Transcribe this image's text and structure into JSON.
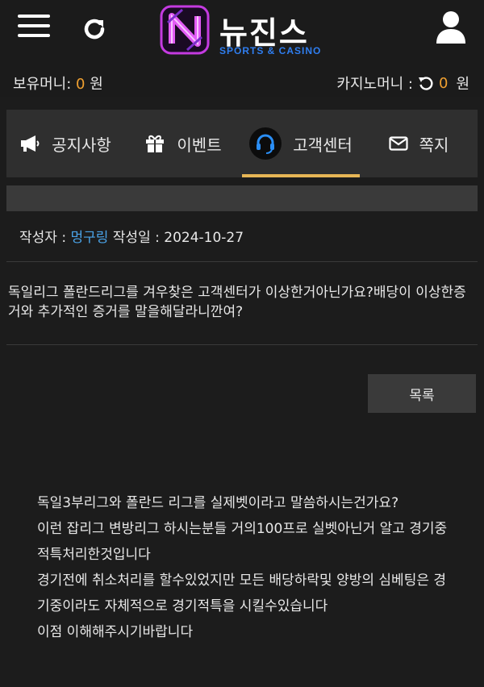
{
  "header": {
    "logo_name": "뉴진스",
    "logo_sub": "SPORTS & CASINO"
  },
  "money": {
    "holding_label": "보유머니:",
    "holding_amount": "0",
    "holding_unit": "원",
    "casino_label": "카지노머니 :",
    "casino_amount": "0",
    "casino_unit": "원"
  },
  "tabs": [
    {
      "label": "공지사항",
      "icon": "megaphone-icon"
    },
    {
      "label": "이벤트",
      "icon": "gift-icon"
    },
    {
      "label": "고객센터",
      "icon": "headset-icon",
      "active": true
    },
    {
      "label": "쪽지",
      "icon": "envelope-icon"
    }
  ],
  "post": {
    "author_label": "작성자 :",
    "author": "멍구링",
    "date_label": "작성일 :",
    "date": "2024-10-27",
    "question": "독일리그 폴란드리그를 겨우찾은 고객센터가 이상한거아닌가요?배당이 이상한증거와 추가적인 증거를 말을해달라니깐여?"
  },
  "buttons": {
    "list_label": "목록"
  },
  "answer": {
    "lines": [
      "독일3부리그와  폴란드 리그를  실제벳이라고  말씀하시는건가요?",
      "이런  잡리그  변방리그 하시는분들  거의100프로  실벳아닌거 알고  경기중  적특처리한것입니다",
      "경기전에  취소처리를  할수있었지만  모든 배당하락및  양방의 심베팅은  경기중이라도  자체적으로  경기적특을  시킬수있습니다",
      "이점  이해해주시기바랍니다"
    ]
  },
  "colors": {
    "accent": "#e7b656",
    "amount": "#f0a030",
    "author": "#4aa3e8",
    "logo_sub": "#2f7ef0"
  }
}
